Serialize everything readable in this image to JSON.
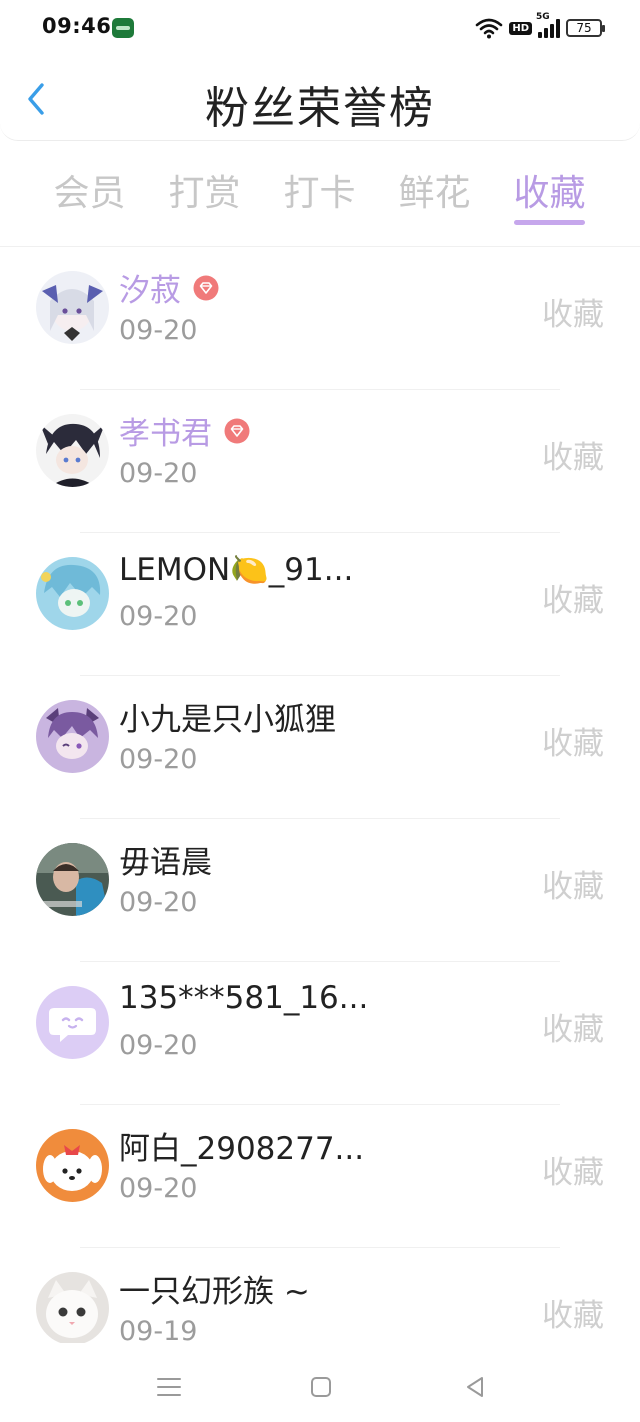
{
  "status_bar": {
    "time": "09:46",
    "hd": "HD",
    "network": "5G",
    "battery": "75",
    "icons": [
      "app-notification-icon",
      "wifi-icon",
      "hd-icon",
      "signal-icon",
      "battery-icon"
    ]
  },
  "header": {
    "title": "粉丝荣誉榜",
    "back_icon": "chevron-left-icon"
  },
  "tabs": [
    {
      "label": "会员",
      "active": false
    },
    {
      "label": "打赏",
      "active": false
    },
    {
      "label": "打卡",
      "active": false
    },
    {
      "label": "鲜花",
      "active": false
    },
    {
      "label": "收藏",
      "active": true
    }
  ],
  "fans": [
    {
      "name": "汐菽",
      "date": "09-20",
      "action": "收藏",
      "vip": true
    },
    {
      "name": "孝书君",
      "date": "09-20",
      "action": "收藏",
      "vip": true
    },
    {
      "name": "LEMON🍋_91...",
      "date": "09-20",
      "action": "收藏",
      "vip": false
    },
    {
      "name": "小九是只小狐狸",
      "date": "09-20",
      "action": "收藏",
      "vip": false
    },
    {
      "name": "毋语晨",
      "date": "09-20",
      "action": "收藏",
      "vip": false
    },
    {
      "name": "135***581_16...",
      "date": "09-20",
      "action": "收藏",
      "vip": false
    },
    {
      "name": "阿白_2908277...",
      "date": "09-20",
      "action": "收藏",
      "vip": false
    },
    {
      "name": "一只幻形族 ~",
      "date": "09-19",
      "action": "收藏",
      "vip": false
    }
  ],
  "nav": [
    "menu-icon",
    "home-icon",
    "back-icon"
  ],
  "colors": {
    "accent": "#b89be4",
    "tab_inactive": "#c7c7c7",
    "back_arrow": "#3a9ee8",
    "vip_badge": "#f07a7a"
  }
}
